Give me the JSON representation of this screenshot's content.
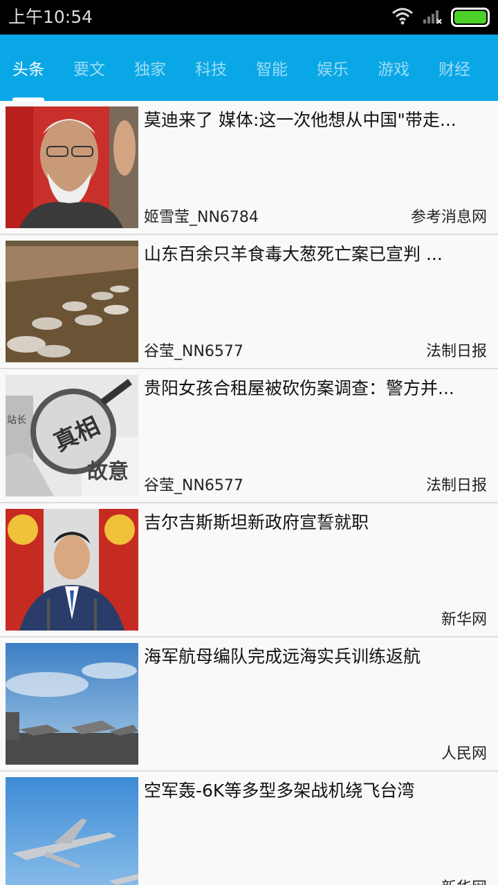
{
  "status_bar": {
    "time": "上午10:54",
    "icons": [
      "wifi-icon",
      "signal-icon",
      "battery-icon"
    ],
    "battery_color": "#4cd12b"
  },
  "tabs": [
    {
      "label": "头条",
      "active": true
    },
    {
      "label": "要文",
      "active": false
    },
    {
      "label": "独家",
      "active": false
    },
    {
      "label": "科技",
      "active": false
    },
    {
      "label": "智能",
      "active": false
    },
    {
      "label": "娱乐",
      "active": false
    },
    {
      "label": "游戏",
      "active": false
    },
    {
      "label": "财经",
      "active": false
    }
  ],
  "accent_color": "#0aa7e6",
  "news": [
    {
      "title": "莫迪来了 媒体:这一次他想从中国\"带走...",
      "author": "姬雪莹_NN6784",
      "source": "参考消息网"
    },
    {
      "title": "山东百余只羊食毒大葱死亡案已宣判 ...",
      "author": "谷莹_NN6577",
      "source": "法制日报"
    },
    {
      "title": "贵阳女孩合租屋被砍伤案调查：警方并...",
      "author": "谷莹_NN6577",
      "source": "法制日报",
      "thumb_text": [
        "真相",
        "故意",
        "站长"
      ]
    },
    {
      "title": "吉尔吉斯斯坦新政府宣誓就职",
      "author": "",
      "source": "新华网"
    },
    {
      "title": "海军航母编队完成远海实兵训练返航",
      "author": "",
      "source": "人民网"
    },
    {
      "title": "空军轰-6K等多型多架战机绕飞台湾",
      "author": "",
      "source": "新华网"
    }
  ]
}
